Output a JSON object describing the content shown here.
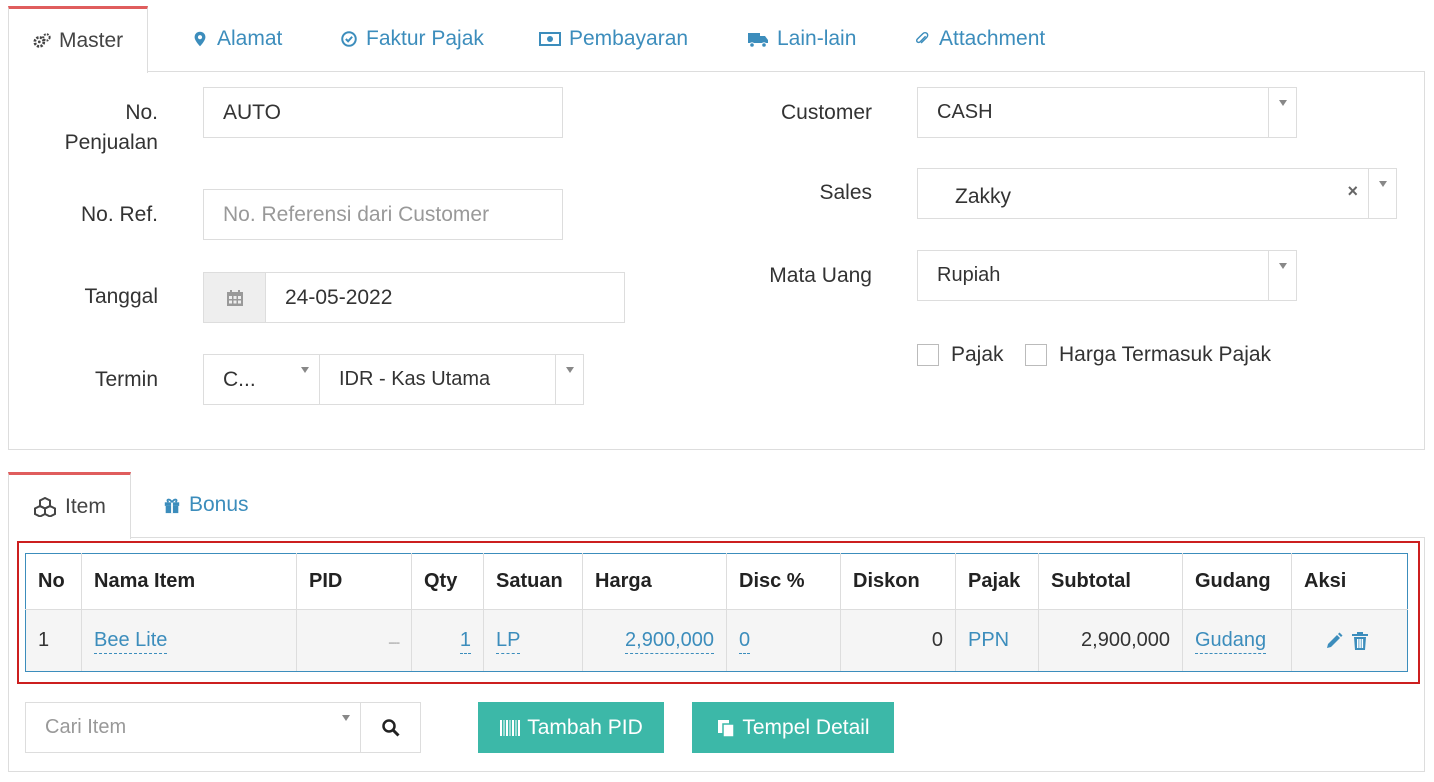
{
  "tabs": [
    {
      "label": "Master",
      "icon": "gears-icon"
    },
    {
      "label": "Alamat",
      "icon": "map-marker-icon"
    },
    {
      "label": "Faktur Pajak",
      "icon": "check-circle-icon"
    },
    {
      "label": "Pembayaran",
      "icon": "money-icon"
    },
    {
      "label": "Lain-lain",
      "icon": "truck-icon"
    },
    {
      "label": "Attachment",
      "icon": "paperclip-icon"
    }
  ],
  "form": {
    "no_penjualan_label_1": "No.",
    "no_penjualan_label_2": "Penjualan",
    "no_penjualan_value": "AUTO",
    "no_ref_label": "No. Ref.",
    "no_ref_placeholder": "No. Referensi dari Customer",
    "tanggal_label": "Tanggal",
    "tanggal_value": "24-05-2022",
    "termin_label": "Termin",
    "termin_value": "C...",
    "kas_value": "IDR - Kas Utama",
    "customer_label": "Customer",
    "customer_value": "CASH",
    "sales_label": "Sales",
    "sales_value": "Zakky",
    "mata_uang_label": "Mata Uang",
    "mata_uang_value": "Rupiah",
    "pajak_label": "Pajak",
    "harga_termasuk_pajak_label": "Harga Termasuk Pajak"
  },
  "item_tabs": [
    {
      "label": "Item",
      "icon": "cubes-icon"
    },
    {
      "label": "Bonus",
      "icon": "gift-icon"
    }
  ],
  "table": {
    "headers": [
      "No",
      "Nama Item",
      "PID",
      "Qty",
      "Satuan",
      "Harga",
      "Disc %",
      "Diskon",
      "Pajak",
      "Subtotal",
      "Gudang",
      "Aksi"
    ],
    "rows": [
      {
        "no": "1",
        "nama_item": "Bee Lite",
        "pid": "----",
        "qty": "1",
        "satuan": "LP",
        "harga": "2,900,000",
        "disc": "0",
        "diskon": "0",
        "pajak": "PPN",
        "subtotal": "2,900,000",
        "gudang": "Gudang"
      }
    ]
  },
  "bottom": {
    "search_placeholder": "Cari Item",
    "tambah_pid_label": "Tambah PID",
    "tempel_detail_label": "Tempel Detail"
  },
  "colors": {
    "accent": "#3c8dbc",
    "teal": "#3cb8a8",
    "highlight": "#cc1f1f",
    "tab_top": "#e05d5d"
  }
}
